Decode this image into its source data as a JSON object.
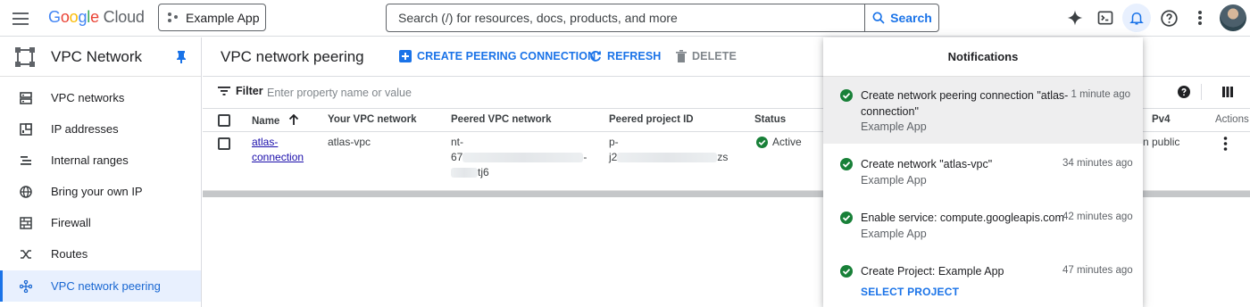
{
  "topbar": {
    "logo_parts": [
      "G",
      "o",
      "o",
      "g",
      "l",
      "e",
      " Cloud"
    ],
    "project_name": "Example App",
    "search_placeholder": "Search (/) for resources, docs, products, and more",
    "search_button": "Search"
  },
  "sidebar": {
    "title": "VPC Network",
    "items": [
      {
        "label": "VPC networks",
        "icon": "vpc-networks-icon"
      },
      {
        "label": "IP addresses",
        "icon": "ip-addresses-icon"
      },
      {
        "label": "Internal ranges",
        "icon": "internal-ranges-icon"
      },
      {
        "label": "Bring your own IP",
        "icon": "globe-icon"
      },
      {
        "label": "Firewall",
        "icon": "firewall-icon"
      },
      {
        "label": "Routes",
        "icon": "routes-icon"
      },
      {
        "label": "VPC network peering",
        "icon": "peering-icon"
      }
    ]
  },
  "main": {
    "title": "VPC network peering",
    "actions": {
      "create": "CREATE PEERING CONNECTION",
      "refresh": "REFRESH",
      "delete": "DELETE"
    },
    "filter": {
      "label": "Filter",
      "placeholder": "Enter property name or value"
    },
    "columns": [
      "Name",
      "Your VPC network",
      "Peered VPC network",
      "Peered project ID",
      "Status",
      "Pv4",
      "Actions"
    ],
    "row": {
      "name_line1": "atlas-",
      "name_line2": "connection",
      "your_vpc": "atlas-vpc",
      "peered_vpc_line1": "nt-",
      "peered_vpc_line2_start": "67",
      "peered_vpc_line2_end": "-",
      "peered_vpc_line3_end": "tj6",
      "project_line1": "p-",
      "project_line2_start": "j2",
      "project_line2_end": "zs",
      "status": "Active",
      "ipv4": "n public"
    }
  },
  "notifications": {
    "title": "Notifications",
    "items": [
      {
        "message_line1": "Create network peering connection \"atlas-",
        "message_line2": "connection\"",
        "time": "1 minute ago",
        "sub": "Example App"
      },
      {
        "message_line1": "Create network \"atlas-vpc\"",
        "message_line2": "",
        "time": "34 minutes ago",
        "sub": "Example App"
      },
      {
        "message_line1": "Enable service: compute.googleapis.com",
        "message_line2": "",
        "time": "42 minutes ago",
        "sub": "Example App"
      },
      {
        "message_line1": "Create Project: Example App",
        "message_line2": "",
        "time": "47 minutes ago",
        "link": "SELECT PROJECT"
      }
    ]
  },
  "colors": {
    "accent": "#1a73e8",
    "success": "#188038",
    "active_bg": "#e8f0fe"
  }
}
